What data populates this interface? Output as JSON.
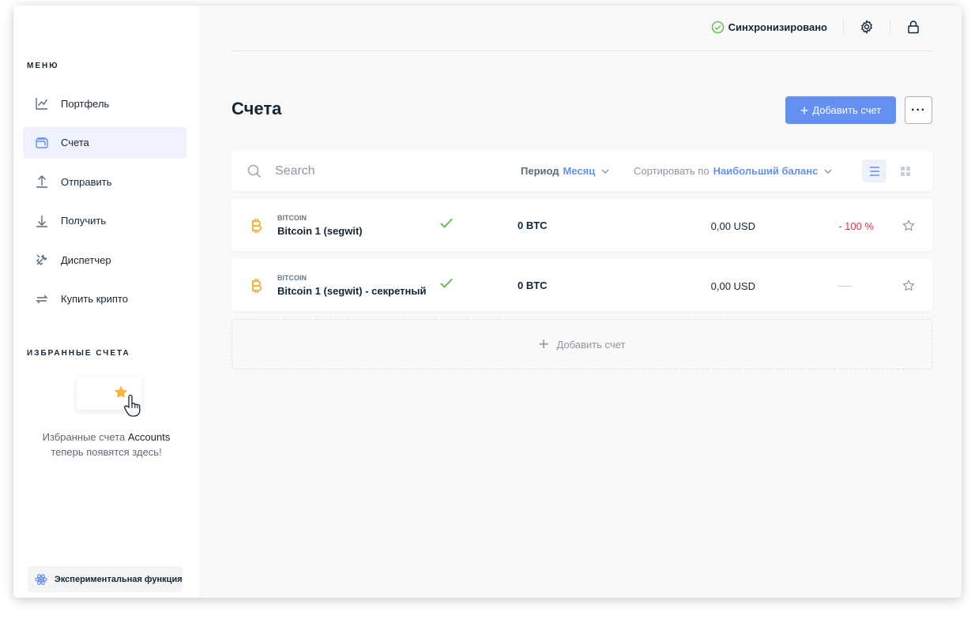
{
  "sidebar": {
    "menu_title": "МЕНЮ",
    "items": [
      {
        "label": "Портфель",
        "icon": "chart-line-icon"
      },
      {
        "label": "Счета",
        "icon": "wallet-icon",
        "active": true
      },
      {
        "label": "Отправить",
        "icon": "arrow-up-icon"
      },
      {
        "label": "Получить",
        "icon": "arrow-down-icon"
      },
      {
        "label": "Диспетчер",
        "icon": "tools-icon"
      },
      {
        "label": "Купить крипто",
        "icon": "exchange-icon"
      }
    ],
    "favorites_title": "ИЗБРАННЫЕ СЧЕТА",
    "favorites_text_1": "Избранные счета",
    "favorites_text_bold": "Accounts",
    "favorites_text_2": "теперь появятся здесь!",
    "experimental_label": "Экспериментальная функция"
  },
  "topbar": {
    "sync_label": "Синхронизировано"
  },
  "page": {
    "title": "Счета",
    "add_button": "Добавить счет",
    "more_button": "···"
  },
  "toolbar": {
    "search_placeholder": "Search",
    "period_label": "Период",
    "period_value": "Месяц",
    "sort_label": "Сортировать по",
    "sort_value": "Наибольший баланс"
  },
  "accounts": [
    {
      "currency": "BITCOIN",
      "name": "Bitcoin 1 (segwit)",
      "balance": "0 BTC",
      "fiat": "0,00 USD",
      "change": "- 100 %"
    },
    {
      "currency": "BITCOIN",
      "name": "Bitcoin 1 (segwit) - секретный",
      "balance": "0 BTC",
      "fiat": "0,00 USD",
      "change": ""
    }
  ],
  "add_account_row": "Добавить счет",
  "colors": {
    "accent": "#6490f1",
    "success": "#66be54",
    "danger": "#ea2e49",
    "bitcoin": "#f7b33c"
  }
}
